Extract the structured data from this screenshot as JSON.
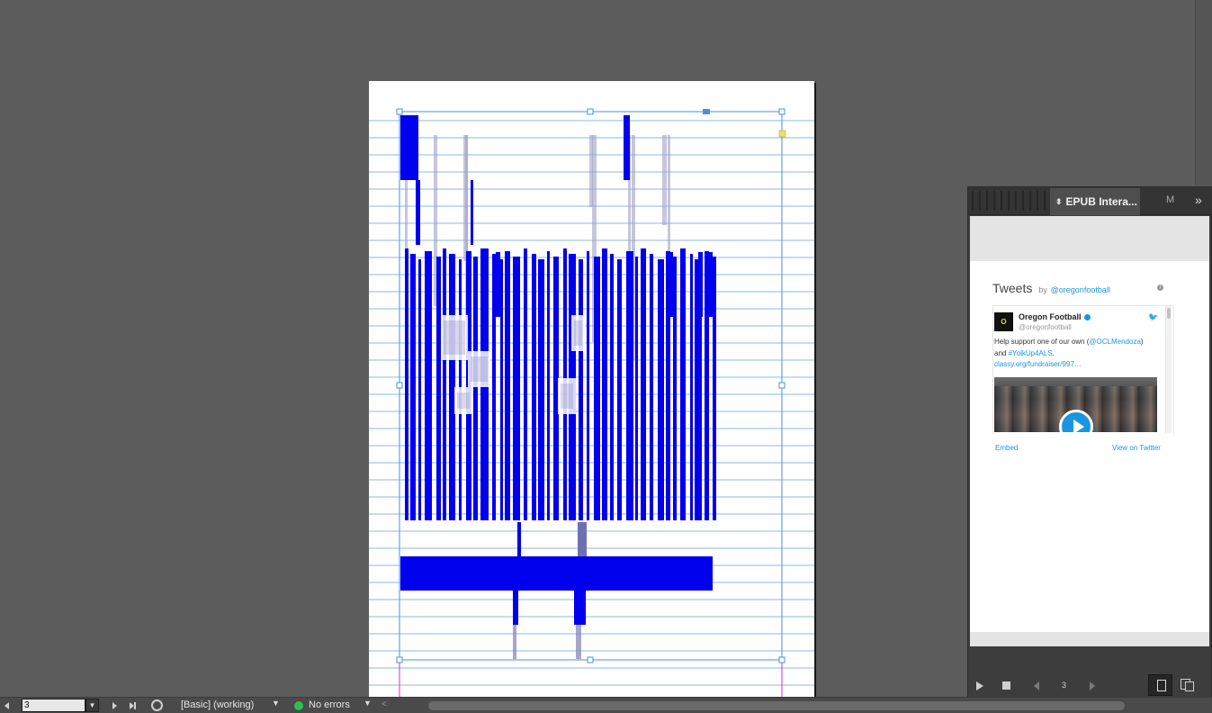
{
  "panel": {
    "tab_title": "EPUB Intera...",
    "second_tab": "M",
    "menu_glyph": "»",
    "page_number": "3"
  },
  "tweets": {
    "header_title": "Tweets",
    "header_by": "by",
    "header_handle": "@oregonfootball",
    "author_name": "Oregon Football",
    "author_handle": "@oregonfootball",
    "avatar_text": "O",
    "text_line1": "Help support one of our own (",
    "text_mention": "@OCLMendoza",
    "text_line1_end": ")",
    "text_line2_pre": "and ",
    "text_hashtag": "#YolkUp4ALS",
    "text_line2_end": ".",
    "text_link": "classy.org/fundraiser/997…",
    "embed_label": "Embed",
    "view_label": "View on Twitter"
  },
  "statusbar": {
    "page_value": "3",
    "profile": "[Basic] (working)",
    "errors": "No errors"
  },
  "colors": {
    "barcode_blue": "#0000ee",
    "guide_blue": "#4a90d9",
    "status_green": "#2ec04a",
    "twitter_blue": "#1b95e0"
  }
}
